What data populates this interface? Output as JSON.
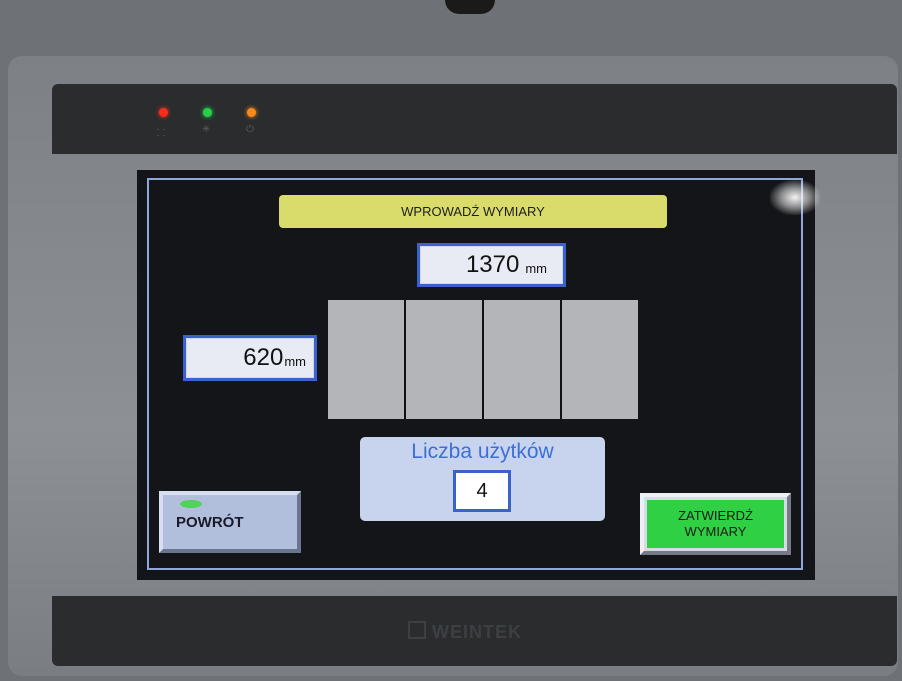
{
  "screen": {
    "title": "WPROWADŹ WYMIARY",
    "width_value": "1370",
    "width_unit": "mm",
    "height_value": "620",
    "height_unit": "mm",
    "panel_count": 4,
    "count_label": "Liczba użytków",
    "count_value": "4"
  },
  "buttons": {
    "back_label": "POWRÓT",
    "confirm_label": "ZATWIERDŹ\nWYMIARY"
  },
  "device": {
    "brand": "WEINTEK",
    "indicators": [
      {
        "name": "network",
        "color": "#ff2a1a",
        "icon": "network-icon"
      },
      {
        "name": "run",
        "color": "#26d14a",
        "icon": "sun-icon"
      },
      {
        "name": "power",
        "color": "#ff8a1a",
        "icon": "power-icon"
      }
    ]
  },
  "colors": {
    "title_bg": "#d9dc6a",
    "field_border": "#3b62c9",
    "confirm_bg": "#2fd044",
    "back_bg": "#b1bfdc",
    "panel": "#b3b5b8"
  }
}
